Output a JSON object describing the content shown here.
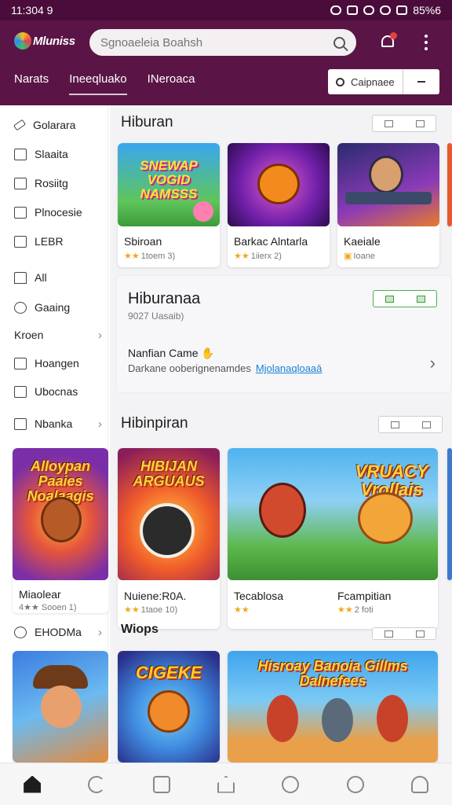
{
  "status_bar": {
    "time": "11:304 9",
    "battery": "85%6"
  },
  "app": {
    "logo_text": "Mluniss",
    "search_placeholder": "Sgnoaeleia Boahsh",
    "tabs": [
      "Narats",
      "Ineeqluako",
      "INeroaca"
    ],
    "compare_label": "Caipnaee"
  },
  "sidebar": {
    "items": [
      {
        "label": "Golarara",
        "icon": "pencil-icon"
      },
      {
        "label": "Slaaita",
        "icon": "image-icon"
      },
      {
        "label": "Rosiitg",
        "icon": "folder-icon"
      },
      {
        "label": "Plnocesie",
        "icon": "grid-icon"
      },
      {
        "label": "LEBR",
        "icon": "square-icon"
      },
      {
        "label": "All",
        "icon": "house-icon"
      },
      {
        "label": "Gaaing",
        "icon": "chat-icon"
      },
      {
        "label": "Kroen",
        "icon": ""
      },
      {
        "label": "Hoangen",
        "icon": "tag-icon"
      },
      {
        "label": "Ubocnas",
        "icon": "book-icon"
      },
      {
        "label": "Nbanka",
        "icon": "grid-icon"
      },
      {
        "label": "EHODMa",
        "icon": "gear-icon"
      }
    ]
  },
  "sections": {
    "first_title": "Hiburan",
    "second_title": "Hibinpiran",
    "small_heading": "Wiops"
  },
  "row1": [
    {
      "title": "Sbiroan",
      "rating": "1toem 3)",
      "thumb_text": "SNEWAP VOGID NAMSSS"
    },
    {
      "title": "Barkac Alntarla",
      "rating": "1iierx 2)",
      "thumb_text": ""
    },
    {
      "title": "Kaeiale",
      "rating": "Ioane",
      "thumb_text": ""
    }
  ],
  "feature": {
    "title": "Hiburanaa",
    "subtitle": "9027 Uasaib)",
    "game_label": "Nanfian Came",
    "desc": "Darkane ooberignenamdes",
    "link": "Mjolanaqloaaā"
  },
  "left_thumb1": {
    "title": "Miaolear",
    "rating": "4★★ Sooen 1)",
    "thumb_text": "Alloypan Paaies Noalaagis"
  },
  "row2": [
    {
      "title": "Nuiene:R0A.",
      "rating": "1taoe 10)",
      "thumb_text": "HIBIJAN ARGUAUS"
    },
    {
      "title": "Tecablosa",
      "rating": "",
      "thumb_text": ""
    },
    {
      "title": "Fcampitian",
      "rating": "2 foti",
      "thumb_text": "VRUACY Vrollais"
    }
  ],
  "row3": [
    {
      "thumb_text": "CIGEKE"
    },
    {
      "thumb_text": "Hisroay Banoia Gillms Dalnefees"
    }
  ],
  "colors": {
    "appbar": "#5a1546",
    "statusbar": "#4a0d3b",
    "accent_link": "#1b7fd6",
    "star": "#f2a71b"
  },
  "bottom_nav": [
    "home-icon",
    "refresh-icon",
    "news-icon",
    "house-icon",
    "search-icon",
    "check-icon",
    "user-icon"
  ]
}
